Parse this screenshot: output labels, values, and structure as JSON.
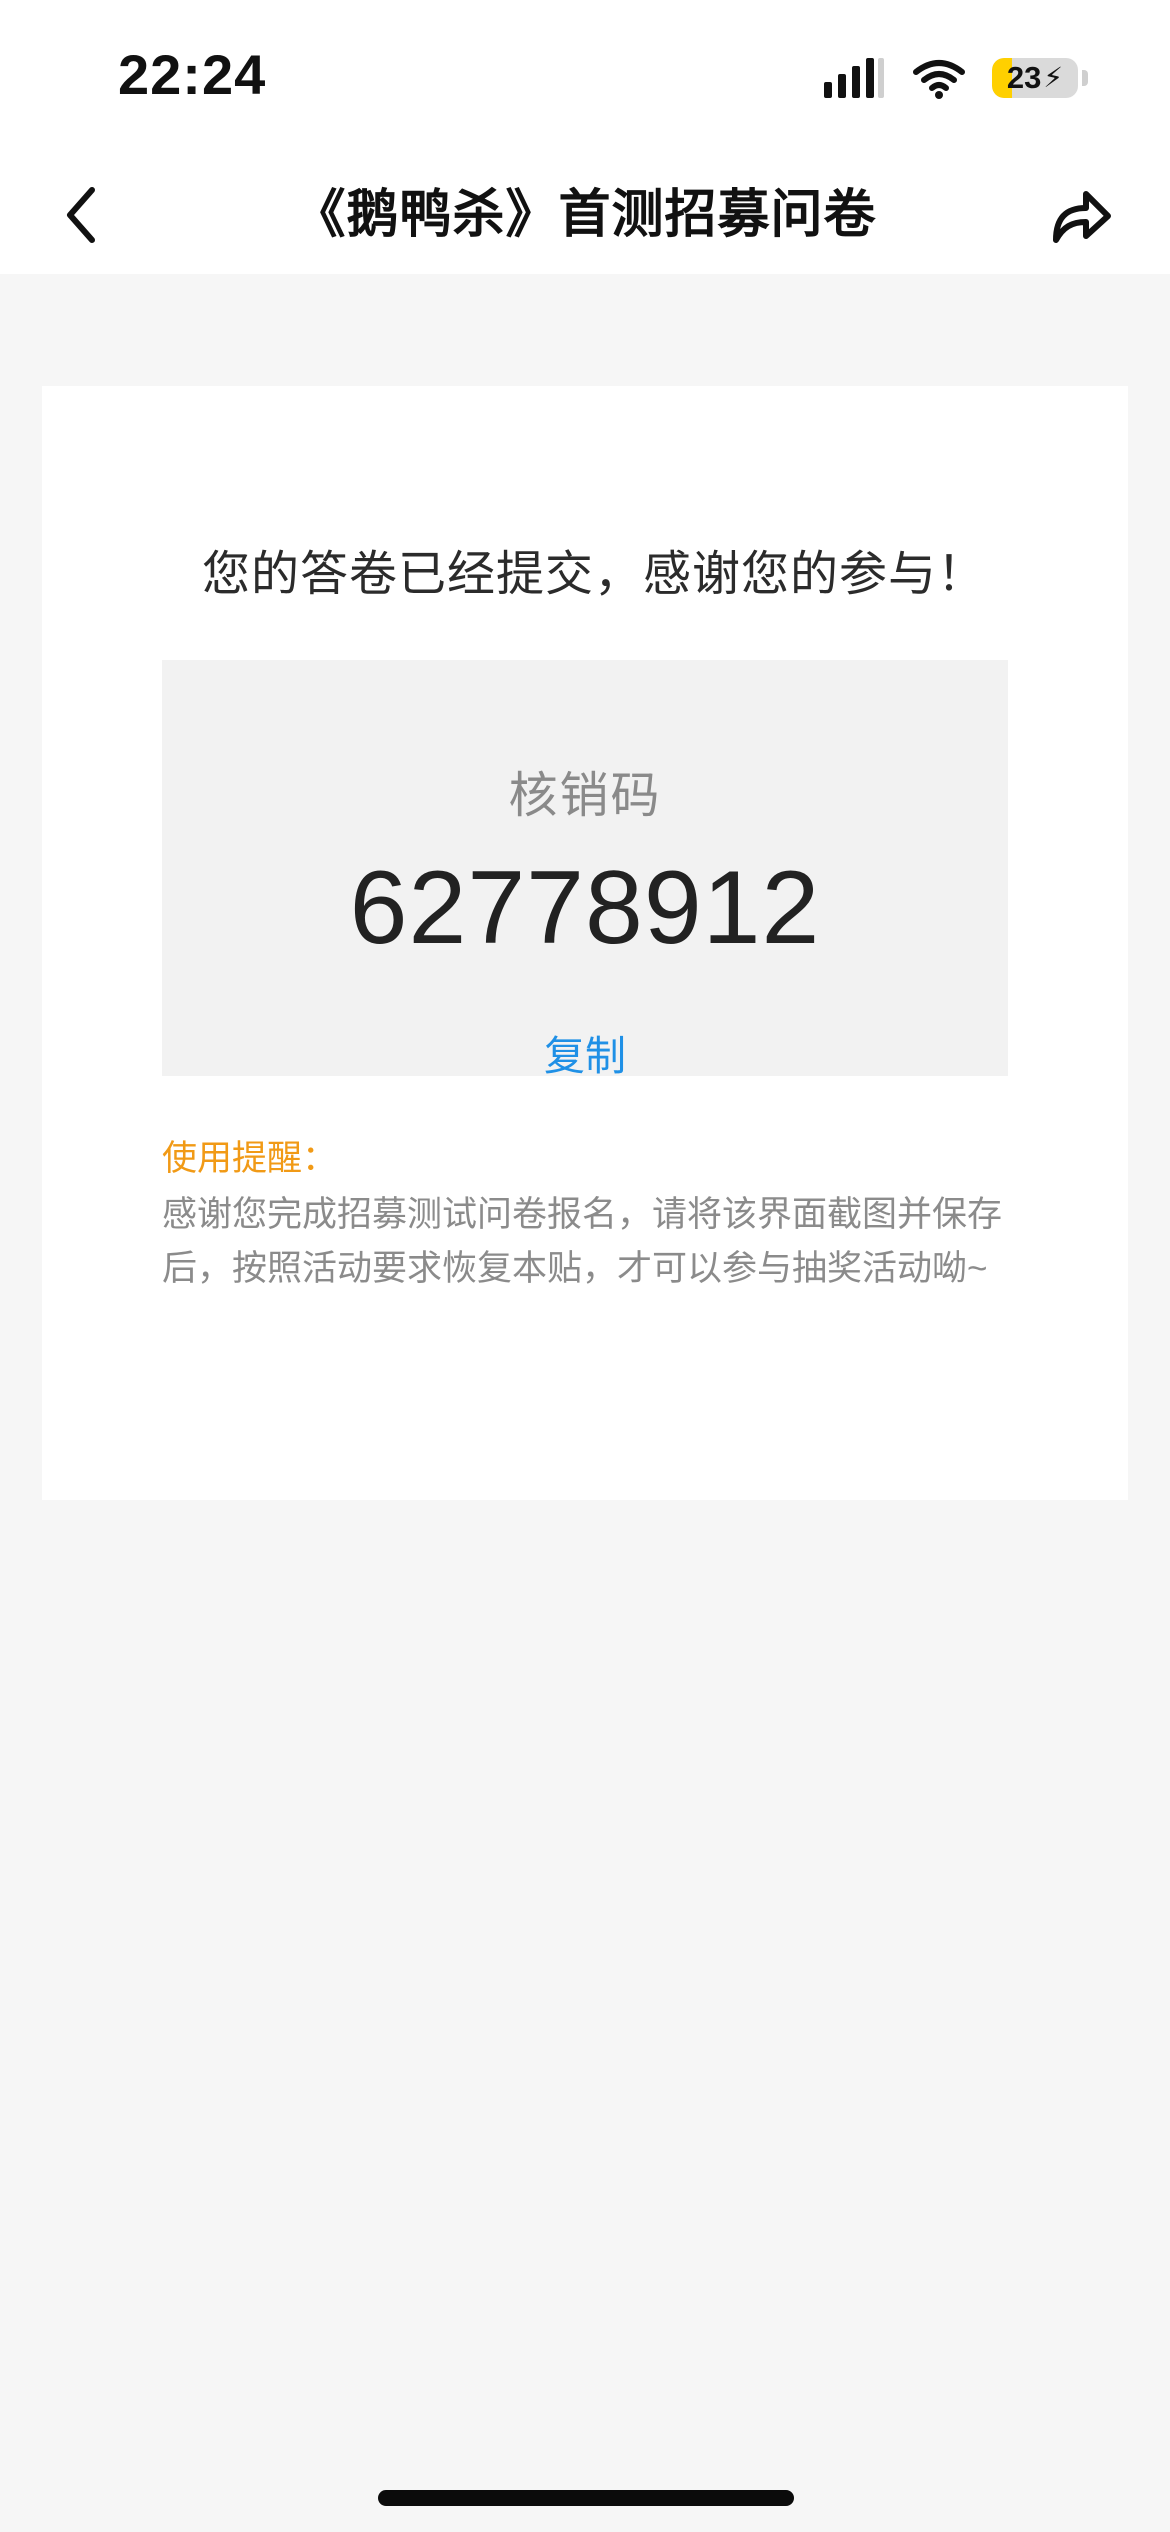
{
  "status_bar": {
    "time": "22:24",
    "battery_percent": "23",
    "battery_level": 0.23,
    "battery_fill_color": "#ffd000",
    "icons": [
      "signal-icon",
      "wifi-icon",
      "battery-icon",
      "charging-bolt-icon"
    ]
  },
  "nav": {
    "title": "《鹅鸭杀》首测招募问卷",
    "back_icon": "chevron-left-icon",
    "share_icon": "share-arrow-icon"
  },
  "content": {
    "success_message": "您的答卷已经提交，感谢您的参与！",
    "code_label": "核销码",
    "code_value": "62778912",
    "copy_label": "复制",
    "tips_title": "使用提醒：",
    "tips_body": "感谢您完成招募测试问卷报名，请将该界面截图并保存后，按照活动要求恢复本贴，才可以参与抽奖活动呦~"
  },
  "colors": {
    "accent_blue": "#1f90e6",
    "tips_orange": "#f19a16",
    "background": "#f6f6f6"
  }
}
